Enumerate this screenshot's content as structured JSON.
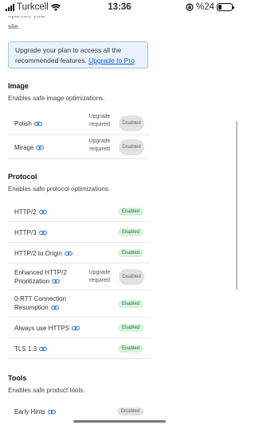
{
  "status_bar": {
    "carrier": "Turkcell",
    "time": "13:36",
    "battery_percent": "%24",
    "battery_level": 0.24
  },
  "intro": {
    "line1": "optimize your",
    "line2": "site."
  },
  "upgrade_notice": {
    "text": "Upgrade your plan to access all the recommended features.",
    "link": "Upgrade to Pro"
  },
  "sections": {
    "image": {
      "title": "Image",
      "description": "Enables safe image optimizations.",
      "rows": [
        {
          "label": "Polish",
          "upgrade": "Upgrade required",
          "status": "Disabled"
        },
        {
          "label": "Mirage",
          "upgrade": "Upgrade required",
          "status": "Disabled"
        }
      ]
    },
    "protocol": {
      "title": "Protocol",
      "description": "Enables safe protocol optimizations.",
      "rows": [
        {
          "label": "HTTP/2",
          "status": "Enabled"
        },
        {
          "label": "HTTP/3",
          "status": "Enabled"
        },
        {
          "label": "HTTP/2 to Origin",
          "status": "Enabled"
        },
        {
          "label_line1": "Enhanced HTTP/2",
          "label_line2": "Prioritization",
          "upgrade": "Upgrade required",
          "status": "Disabled"
        },
        {
          "label_line1": "0-RTT Connection",
          "label_line2": "Resumption",
          "status": "Enabled"
        },
        {
          "label": "Always use HTTPS",
          "status": "Enabled"
        },
        {
          "label": "TLS 1.3",
          "status": "Enabled"
        }
      ]
    },
    "tools": {
      "title": "Tools",
      "description": "Enables safe product tools.",
      "rows": [
        {
          "label": "Early Hints",
          "status": "Disabled"
        }
      ]
    }
  },
  "icons": {
    "link": "link-icon",
    "wifi": "wifi-icon",
    "signal": "signal-icon",
    "battery": "battery-icon",
    "orientation_lock": "orientation-lock-icon"
  },
  "colors": {
    "enabled_bg": "#d7f2df",
    "enabled_text": "#1b7a3a",
    "disabled_bg": "#e2e2e2",
    "link": "#0a5cd1",
    "notice_bg": "#eaf3fc"
  }
}
